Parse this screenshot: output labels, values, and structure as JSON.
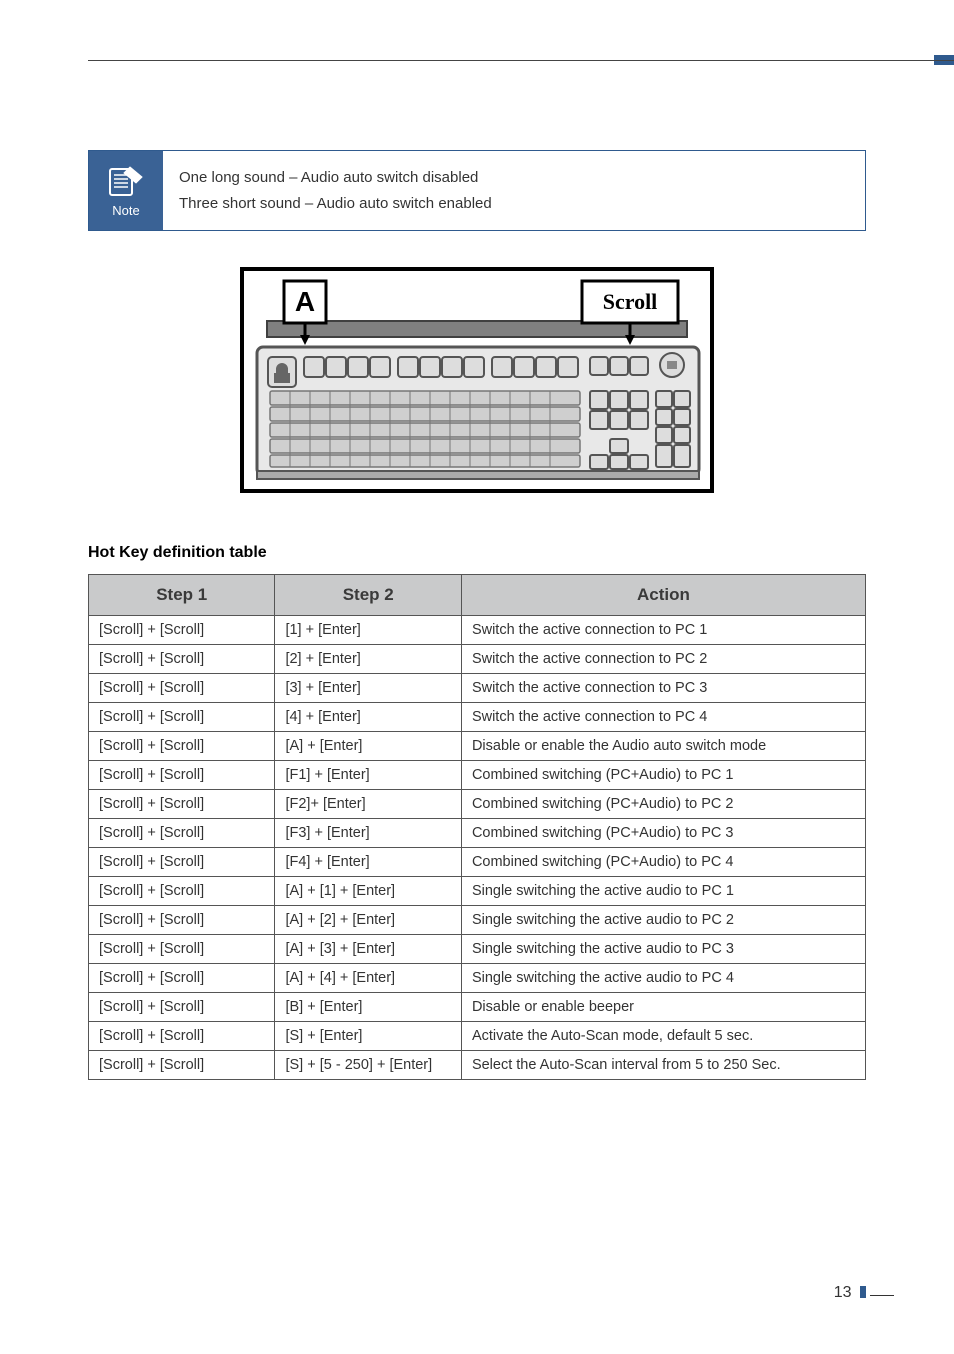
{
  "note": {
    "label": "Note",
    "line1": "One long sound – Audio auto switch disabled",
    "line2": "Three short sound – Audio auto switch enabled"
  },
  "figure": {
    "key_a": "A",
    "key_scroll": "Scroll"
  },
  "heading": "Hot Key definition table",
  "table": {
    "headers": {
      "step1": "Step 1",
      "step2": "Step 2",
      "action": "Action"
    },
    "rows": [
      {
        "s1": "[Scroll] + [Scroll]",
        "s2": "[1] + [Enter]",
        "a": "Switch the active connection to PC 1"
      },
      {
        "s1": "[Scroll] + [Scroll]",
        "s2": "[2] + [Enter]",
        "a": "Switch the active connection to PC 2"
      },
      {
        "s1": "[Scroll] + [Scroll]",
        "s2": "[3] + [Enter]",
        "a": "Switch the active connection to PC 3"
      },
      {
        "s1": "[Scroll] + [Scroll]",
        "s2": "[4] + [Enter]",
        "a": "Switch the active connection to PC 4"
      },
      {
        "s1": "[Scroll] + [Scroll]",
        "s2": "[A] + [Enter]",
        "a": "Disable or enable the Audio auto switch mode"
      },
      {
        "s1": "[Scroll] + [Scroll]",
        "s2": "[F1] + [Enter]",
        "a": "Combined switching (PC+Audio) to PC 1"
      },
      {
        "s1": "[Scroll] + [Scroll]",
        "s2": "[F2]+ [Enter]",
        "a": "Combined switching (PC+Audio) to PC 2"
      },
      {
        "s1": "[Scroll] + [Scroll]",
        "s2": "[F3] + [Enter]",
        "a": "Combined switching (PC+Audio) to PC 3"
      },
      {
        "s1": "[Scroll] + [Scroll]",
        "s2": "[F4] + [Enter]",
        "a": "Combined switching (PC+Audio) to PC 4"
      },
      {
        "s1": "[Scroll] + [Scroll]",
        "s2": "[A] + [1] + [Enter]",
        "a": "Single switching the active audio to PC 1"
      },
      {
        "s1": "[Scroll] + [Scroll]",
        "s2": "[A] + [2] + [Enter]",
        "a": "Single switching the active audio to PC 2"
      },
      {
        "s1": "[Scroll] + [Scroll]",
        "s2": "[A] + [3] + [Enter]",
        "a": "Single switching the active audio to PC 3"
      },
      {
        "s1": "[Scroll] + [Scroll]",
        "s2": "[A] + [4] + [Enter]",
        "a": "Single switching the active audio to PC 4"
      },
      {
        "s1": "[Scroll] + [Scroll]",
        "s2": "[B] + [Enter]",
        "a": "Disable or enable beeper"
      },
      {
        "s1": "[Scroll] + [Scroll]",
        "s2": "[S] + [Enter]",
        "a": "Activate the Auto-Scan mode, default 5 sec."
      },
      {
        "s1": "[Scroll] + [Scroll]",
        "s2": "[S] + [5 - 250] + [Enter]",
        "a": "Select the Auto-Scan interval from 5 to 250 Sec."
      }
    ]
  },
  "page": "13"
}
